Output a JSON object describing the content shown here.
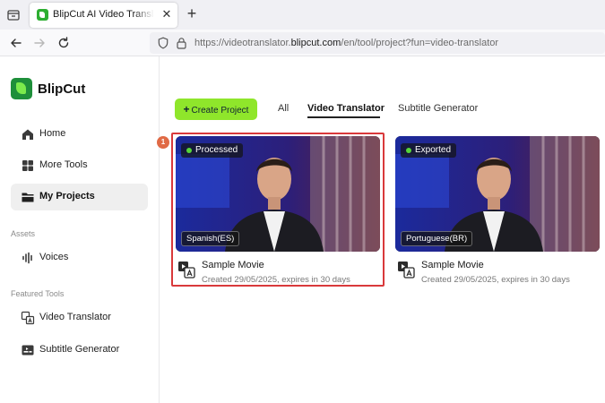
{
  "browser": {
    "tab_title": "BlipCut AI Video Translator - Fa",
    "url_prefix": "https://videotranslator.",
    "url_domain": "blipcut.com",
    "url_suffix": "/en/tool/project?fun=video-translator"
  },
  "sidebar": {
    "brand": "BlipCut",
    "items": [
      {
        "label": "Home",
        "icon": "home-icon"
      },
      {
        "label": "More Tools",
        "icon": "grid-icon"
      },
      {
        "label": "My Projects",
        "icon": "folder-icon",
        "active": true
      }
    ],
    "assets_label": "Assets",
    "assets_items": [
      {
        "label": "Voices",
        "icon": "waveform-icon"
      }
    ],
    "featured_label": "Featured Tools",
    "featured_items": [
      {
        "label": "Video Translator",
        "icon": "translate-icon"
      },
      {
        "label": "Subtitle Generator",
        "icon": "subtitle-icon"
      }
    ]
  },
  "main": {
    "create_label": "Create Project",
    "filters": [
      {
        "label": "All"
      },
      {
        "label": "Video Translator",
        "active": true
      },
      {
        "label": "Subtitle Generator"
      }
    ],
    "step_number": "1",
    "projects": [
      {
        "status": "Processed",
        "language": "Spanish(ES)",
        "title": "Sample Movie",
        "meta": "Created 29/05/2025, expires in 30 days"
      },
      {
        "status": "Exported",
        "language": "Portuguese(BR)",
        "title": "Sample Movie",
        "meta": "Created 29/05/2025, expires in 30 days"
      }
    ]
  },
  "colors": {
    "accent_green": "#8fe62b",
    "status_dot": "#56d63a",
    "highlight": "#d9393b",
    "step_badge": "#e06a45"
  }
}
